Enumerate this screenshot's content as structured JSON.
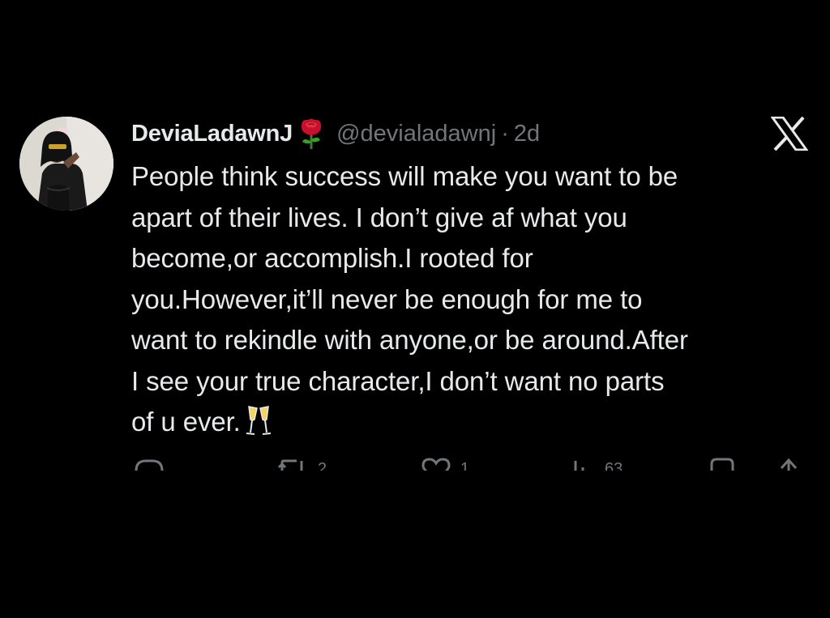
{
  "tweet": {
    "display_name": "DeviaLadawnJ",
    "name_emoji": "rose-emoji",
    "handle": "@devialadawnj",
    "separator": "·",
    "timestamp": "2d",
    "platform_logo": "x-logo",
    "body_lines": [
      "People think success will make you want to be",
      "apart of their lives. I don’t give af what you",
      "become,or accomplish.I rooted for",
      "you.However,it’ll never be enough for me to",
      "want to rekindle with anyone,or be around.After",
      "I see your true character,I don’t want no parts",
      "of u ever."
    ],
    "trailing_emoji": "champagne-glasses-emoji",
    "actions": {
      "reply": {
        "icon": "reply-icon"
      },
      "retweet": {
        "icon": "retweet-icon",
        "count": "2"
      },
      "like": {
        "icon": "heart-icon",
        "count": "1"
      },
      "views": {
        "icon": "views-icon",
        "count": "63"
      },
      "bookmark": {
        "icon": "bookmark-icon"
      },
      "share": {
        "icon": "share-icon"
      }
    }
  },
  "colors": {
    "background": "#000000",
    "primary_text": "#e7e9ea",
    "secondary_text": "#71767b"
  }
}
